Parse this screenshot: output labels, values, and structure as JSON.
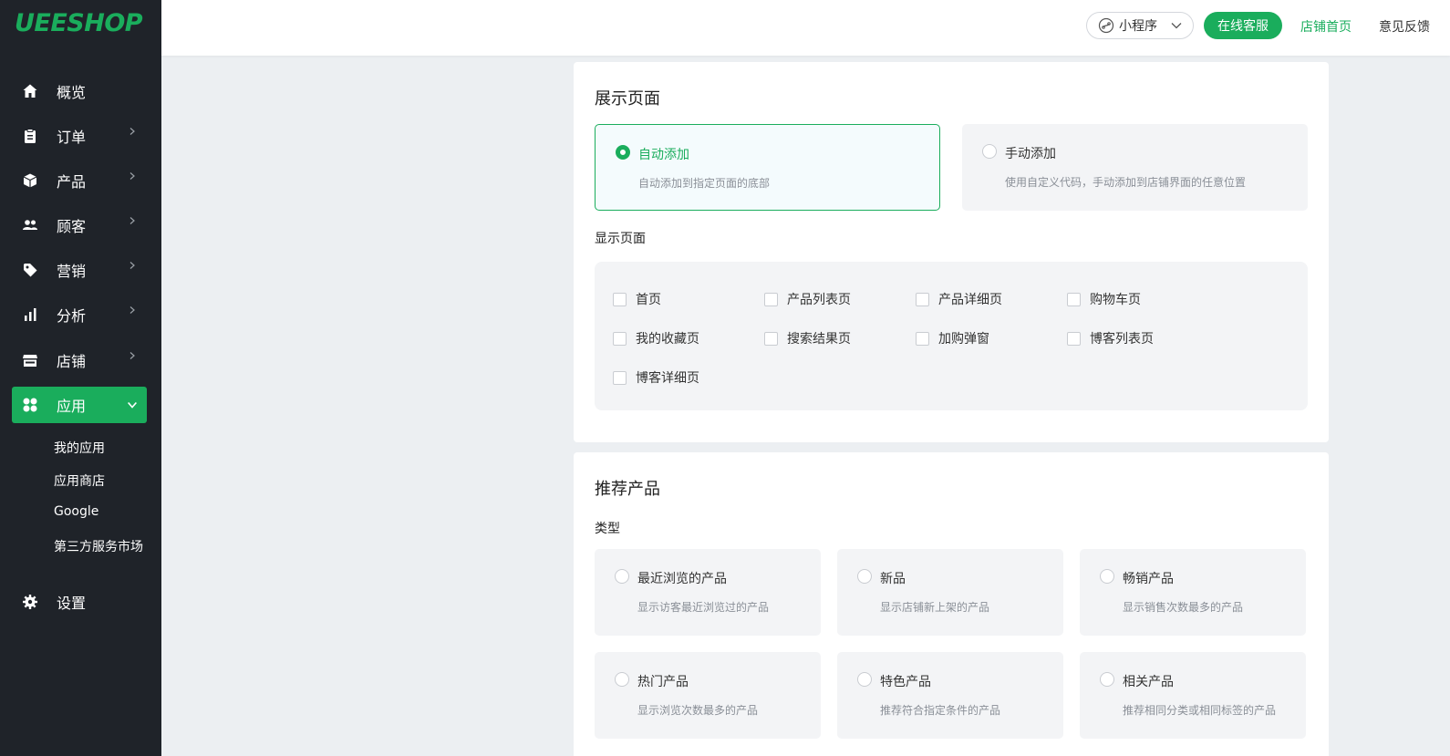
{
  "brand": {
    "logo": "UEESHOP",
    "accent": "#1aad5c",
    "sidebar_bg": "#1f2329"
  },
  "sidebar": {
    "items": [
      {
        "label": "概览",
        "icon": "home-icon",
        "has_children": false
      },
      {
        "label": "订单",
        "icon": "clipboard-icon",
        "has_children": true
      },
      {
        "label": "产品",
        "icon": "box-icon",
        "has_children": true
      },
      {
        "label": "顾客",
        "icon": "users-icon",
        "has_children": true
      },
      {
        "label": "营销",
        "icon": "tag-icon",
        "has_children": true
      },
      {
        "label": "分析",
        "icon": "bar-chart-icon",
        "has_children": true
      },
      {
        "label": "店铺",
        "icon": "store-icon",
        "has_children": true
      },
      {
        "label": "应用",
        "icon": "apps-icon",
        "has_children": true,
        "active": true
      }
    ],
    "sub_items": [
      "我的应用",
      "应用商店",
      "Google",
      "第三方服务市场"
    ],
    "settings": {
      "label": "设置",
      "icon": "gear-icon"
    }
  },
  "topbar": {
    "mini_program": "小程序",
    "service_button": "在线客服",
    "store_home_link": "店铺首页",
    "feedback_link": "意见反馈"
  },
  "display_section": {
    "title": "展示页面",
    "options": [
      {
        "title": "自动添加",
        "desc": "自动添加到指定页面的底部",
        "selected": true
      },
      {
        "title": "手动添加",
        "desc": "使用自定义代码，手动添加到店铺界面的任意位置",
        "selected": false
      }
    ],
    "pages_label": "显示页面",
    "pages": [
      "首页",
      "产品列表页",
      "产品详细页",
      "购物车页",
      "我的收藏页",
      "搜索结果页",
      "加购弹窗",
      "博客列表页",
      "博客详细页"
    ]
  },
  "recommend_section": {
    "title": "推荐产品",
    "type_label": "类型",
    "types": [
      {
        "title": "最近浏览的产品",
        "desc": "显示访客最近浏览过的产品"
      },
      {
        "title": "新品",
        "desc": "显示店铺新上架的产品"
      },
      {
        "title": "畅销产品",
        "desc": "显示销售次数最多的产品"
      },
      {
        "title": "热门产品",
        "desc": "显示浏览次数最多的产品"
      },
      {
        "title": "特色产品",
        "desc": "推荐符合指定条件的产品"
      },
      {
        "title": "相关产品",
        "desc": "推荐相同分类或相同标签的产品"
      }
    ]
  }
}
